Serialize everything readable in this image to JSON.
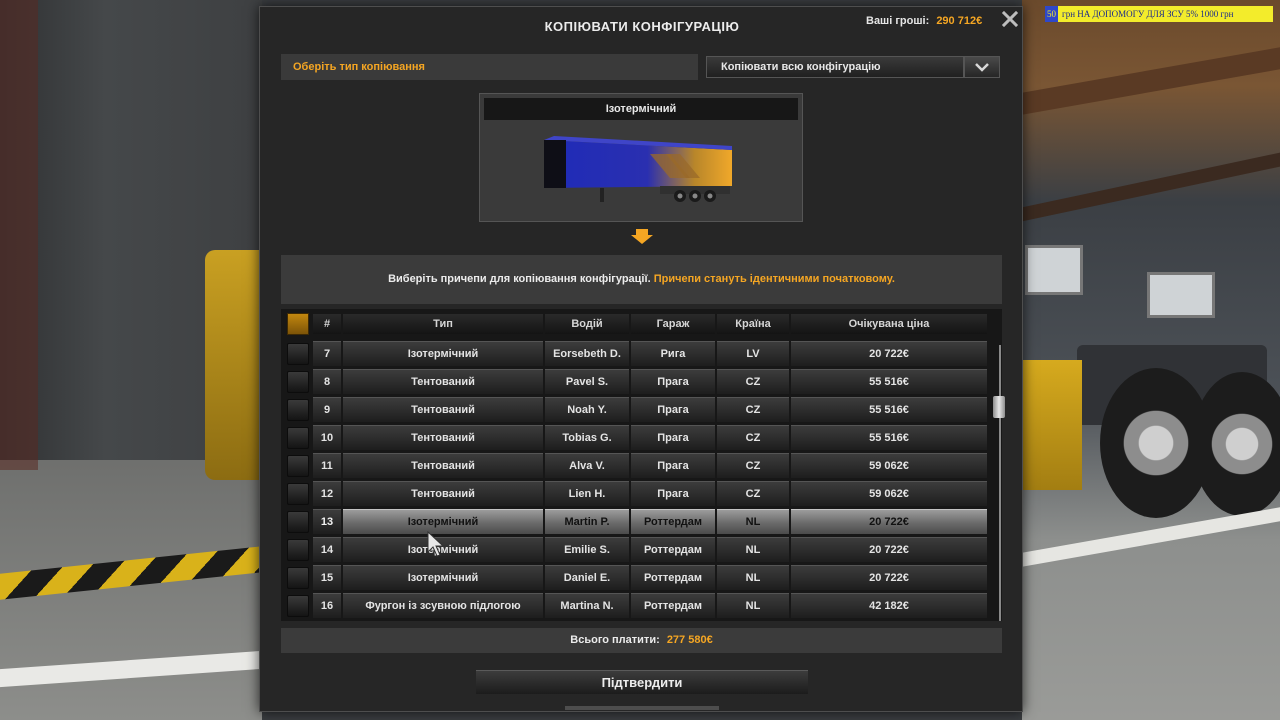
{
  "dialog": {
    "title": "КОПІЮВАТИ КОНФІГУРАЦІЮ",
    "money_label": "Ваші гроші:",
    "money_value": "290 712€",
    "close_icon": "close-icon"
  },
  "banner": {
    "number": "50",
    "text": "грн   НА ДОПОМОГУ ДЛЯ ЗСУ 5%   1000 грн"
  },
  "copy_type": {
    "label": "Оберіть тип копіювання",
    "selected": "Копіювати всю конфігурацію",
    "dropdown_icon": "chevron-down-icon"
  },
  "source": {
    "title": "Ізотермічний",
    "image": "trailer-preview-image"
  },
  "info": {
    "text": "Виберіть причепи для копіювання конфігурації.",
    "highlight": "Причепи стануть ідентичними початковому."
  },
  "table": {
    "headers": {
      "num": "#",
      "type": "Тип",
      "driver": "Водій",
      "garage": "Гараж",
      "country": "Країна",
      "price": "Очікувана ціна"
    },
    "rows": [
      {
        "num": "7",
        "type": "Ізотермічний",
        "driver": "Eorsebeth D.",
        "garage": "Рига",
        "country": "LV",
        "price": "20 722€",
        "selected": false
      },
      {
        "num": "8",
        "type": "Тентований",
        "driver": "Pavel S.",
        "garage": "Прага",
        "country": "CZ",
        "price": "55 516€",
        "selected": false
      },
      {
        "num": "9",
        "type": "Тентований",
        "driver": "Noah Y.",
        "garage": "Прага",
        "country": "CZ",
        "price": "55 516€",
        "selected": false
      },
      {
        "num": "10",
        "type": "Тентований",
        "driver": "Tobias G.",
        "garage": "Прага",
        "country": "CZ",
        "price": "55 516€",
        "selected": false
      },
      {
        "num": "11",
        "type": "Тентований",
        "driver": "Alva V.",
        "garage": "Прага",
        "country": "CZ",
        "price": "59 062€",
        "selected": false
      },
      {
        "num": "12",
        "type": "Тентований",
        "driver": "Lien H.",
        "garage": "Прага",
        "country": "CZ",
        "price": "59 062€",
        "selected": false
      },
      {
        "num": "13",
        "type": "Ізотермічний",
        "driver": "Martin P.",
        "garage": "Роттердам",
        "country": "NL",
        "price": "20 722€",
        "selected": true
      },
      {
        "num": "14",
        "type": "Ізотермічний",
        "driver": "Emilie S.",
        "garage": "Роттердам",
        "country": "NL",
        "price": "20 722€",
        "selected": false
      },
      {
        "num": "15",
        "type": "Ізотермічний",
        "driver": "Daniel E.",
        "garage": "Роттердам",
        "country": "NL",
        "price": "20 722€",
        "selected": false
      },
      {
        "num": "16",
        "type": "Фургон із зсувною підлогою",
        "driver": "Martina N.",
        "garage": "Роттердам",
        "country": "NL",
        "price": "42 182€",
        "selected": false
      }
    ]
  },
  "total": {
    "label": "Всього платити:",
    "value": "277 580€"
  },
  "confirm": {
    "label": "Підтвердити"
  },
  "colors": {
    "accent": "#f5a623",
    "panel": "#262626",
    "selected_row": "#7a7a7a"
  }
}
